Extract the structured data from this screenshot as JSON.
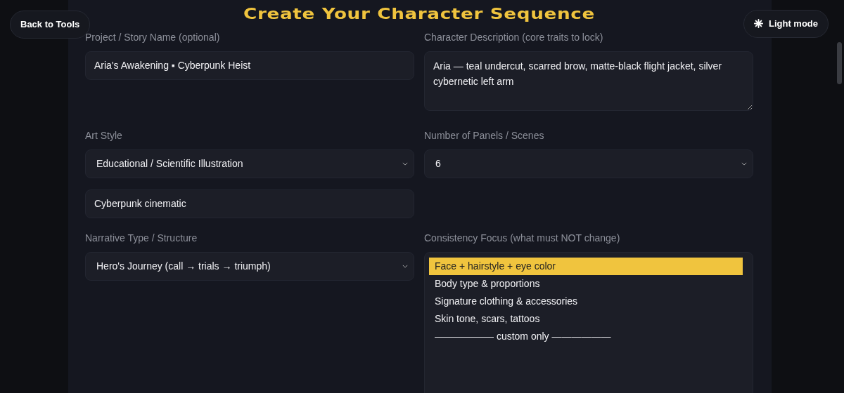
{
  "back_button": "Back to Tools",
  "title": "Create Your Character Sequence",
  "theme_button": "Light mode",
  "fields": [
    {
      "kind": "input",
      "label": "Project / Story Name (optional)",
      "value": "Aria's Awakening ▪ Cyberpunk Heist"
    },
    {
      "kind": "textarea",
      "label": "Character Description (core traits to lock)",
      "value": "Aria — teal undercut, scarred brow, matte-black flight jacket, silver cybernetic left arm"
    },
    {
      "kind": "select",
      "label": "Art Style",
      "value": "Educational / Scientific Illustration"
    },
    {
      "kind": "select",
      "label": "Number of Panels / Scenes",
      "value": "6"
    },
    {
      "kind": "input",
      "value": "Cyberpunk cinematic"
    },
    {
      "kind": "blank"
    },
    {
      "kind": "select",
      "label": "Narrative Type / Structure",
      "value": "Hero's Journey (call → trials → triumph)"
    },
    {
      "kind": "listbox",
      "label": "Consistency Focus (what must NOT change)",
      "options": [
        {
          "text": "Face + hairstyle + eye color",
          "selected": true
        },
        {
          "text": "Body type & proportions",
          "selected": false
        },
        {
          "text": "Signature clothing & accessories",
          "selected": false
        },
        {
          "text": "Skin tone, scars, tattoos",
          "selected": false
        },
        {
          "text": "—————— custom only ——————",
          "selected": false
        }
      ]
    }
  ]
}
